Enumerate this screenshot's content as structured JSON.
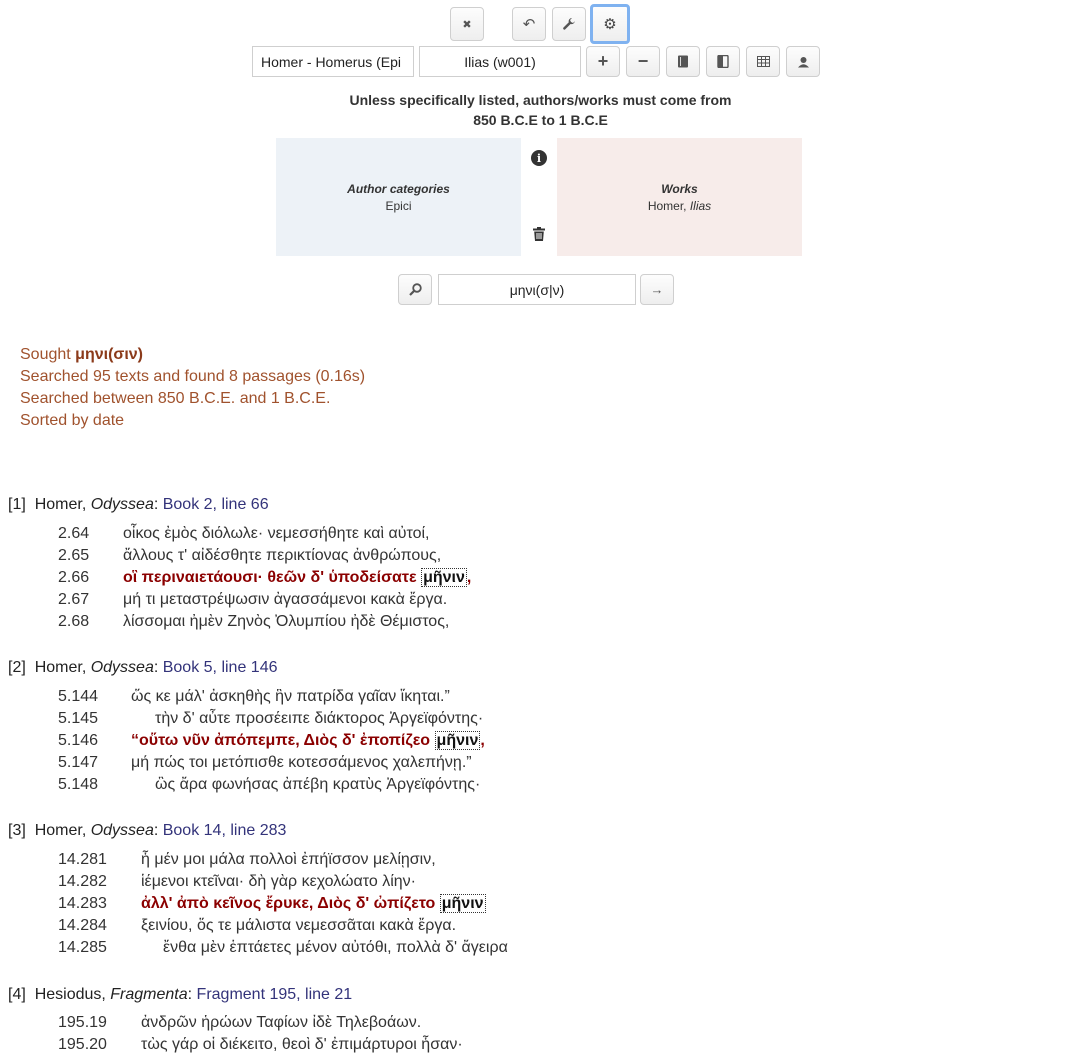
{
  "toolbar": {
    "buttons": [
      {
        "name": "close-button",
        "icon": "close-icon",
        "glyph": "✖"
      },
      {
        "name": "undo-button",
        "icon": "undo-icon",
        "glyph": "↶"
      },
      {
        "name": "wrench-button",
        "icon": "wrench-icon",
        "glyph": "🔧"
      },
      {
        "name": "settings-button",
        "icon": "gear-icon",
        "glyph": "⚙"
      }
    ]
  },
  "selectors": {
    "author_value": "Homer - Homerus (Epi",
    "work_value": "Ilias (w001)",
    "plus_glyph": "+",
    "minus_glyph": "−",
    "icon_buttons": [
      {
        "name": "book-button",
        "icon": "book-icon",
        "glyph": "▐"
      },
      {
        "name": "open-book-button",
        "icon": "open-book-icon",
        "glyph": "◧"
      },
      {
        "name": "table-button",
        "icon": "table-icon",
        "glyph": "▦"
      },
      {
        "name": "user-button",
        "icon": "user-icon",
        "glyph": "♙"
      }
    ]
  },
  "date_note": {
    "line1": "Unless specifically listed, authors/works must come from",
    "line2": "850 B.C.E to 1 B.C.E"
  },
  "panels": {
    "author_title": "Author categories",
    "author_value": "Epici",
    "works_title": "Works",
    "works_author": "Homer, ",
    "works_title_value": "Ilias",
    "colors": {
      "author_bg": "#edf2f7",
      "works_bg": "#f7ecea"
    }
  },
  "search": {
    "query": "μηνι(σ|ν)",
    "search_glyph": "🔎",
    "go_glyph": "→"
  },
  "status": {
    "sought_label": "Sought ",
    "sought_term": "μηνι(σιν)",
    "found": "Searched 95 texts and found 8 passages (0.16s)",
    "range": "Searched between 850 B.C.E. and 1 B.C.E.",
    "sort": "Sorted by date"
  },
  "results": [
    {
      "index": "[1]",
      "author": "Homer, ",
      "work": "Odyssea",
      "sep": ": ",
      "citation": "Book 2, line 66",
      "lines": [
        {
          "num": "2.64",
          "text": "οἶκος ἐμὸς διόλωλε· νεμεσσήθητε καὶ αὐτοί,"
        },
        {
          "num": "2.65",
          "text": "ἄλλους τ' αἰδέσθητε περικτίονας ἀνθρώπους,"
        },
        {
          "num": "2.66",
          "hit_before": "οἳ περιναιετάουσι· θεῶν δ' ὑποδείσατε ",
          "hit_word": "μῆνιν",
          "hit_after": ","
        },
        {
          "num": "2.67",
          "text": "μή τι μεταστρέψωσιν ἀγασσάμενοι κακὰ ἔργα."
        },
        {
          "num": "2.68",
          "text": "λίσσομαι ἠμὲν Ζηνὸς Ὀλυμπίου ἠδὲ Θέμιστος,"
        }
      ]
    },
    {
      "index": "[2]",
      "author": "Homer, ",
      "work": "Odyssea",
      "sep": ": ",
      "citation": "Book 5, line 146",
      "lines": [
        {
          "num": "5.144",
          "text": "ὥς κε μάλ' ἀσκηθὴς ἣν πατρίδα γαῖαν ἵκηται.”"
        },
        {
          "num": "5.145",
          "text": "τὴν δ' αὖτε προσέειπε διάκτορος Ἀργεϊφόντης·"
        },
        {
          "num": "5.146",
          "hit_before": "“οὕτω νῦν ἀπόπεμπε, Διὸς δ' ἐποπίζεο ",
          "hit_word": "μῆνιν",
          "hit_after": ","
        },
        {
          "num": "5.147",
          "text": "μή πώς τοι μετόπισθε κοτεσσάμενος χαλεπήνῃ.”"
        },
        {
          "num": "5.148",
          "text": "ὣς ἄρα φωνήσας ἀπέβη κρατὺς Ἀργεϊφόντης·"
        }
      ]
    },
    {
      "index": "[3]",
      "author": "Homer, ",
      "work": "Odyssea",
      "sep": ": ",
      "citation": "Book 14, line 283",
      "lines": [
        {
          "num": "14.281",
          "text": "ἦ μέν μοι μάλα πολλοὶ ἐπήϊσσον μελίῃσιν,"
        },
        {
          "num": "14.282",
          "text": "ἱέμενοι κτεῖναι· δὴ γὰρ κεχολώατο λίην·"
        },
        {
          "num": "14.283",
          "hit_before": "ἀλλ' ἀπὸ κεῖνος ἔρυκε, Διὸς δ' ὠπίζετο ",
          "hit_word": "μῆνιν",
          "hit_after": ""
        },
        {
          "num": "14.284",
          "text": "ξεινίου, ὅς τε μάλιστα νεμεσσᾶται κακὰ ἔργα."
        },
        {
          "num": "14.285",
          "text": "ἔνθα μὲν ἑπτάετες μένον αὐτόθι, πολλὰ δ' ἄγειρα"
        }
      ]
    },
    {
      "index": "[4]",
      "author": "Hesiodus, ",
      "work": "Fragmenta",
      "sep": ": ",
      "citation": "Fragment 195, line 21",
      "lines": [
        {
          "num": "195.19",
          "text": "ἀνδρῶν ἡρώων Ταφίων ἰδὲ Τηλεβοάων."
        },
        {
          "num": "195.20",
          "text": "τὼς γάρ οἱ διέκειτο, θεοὶ δ' ἐπιμάρτυροι ἦσαν·"
        }
      ]
    }
  ]
}
